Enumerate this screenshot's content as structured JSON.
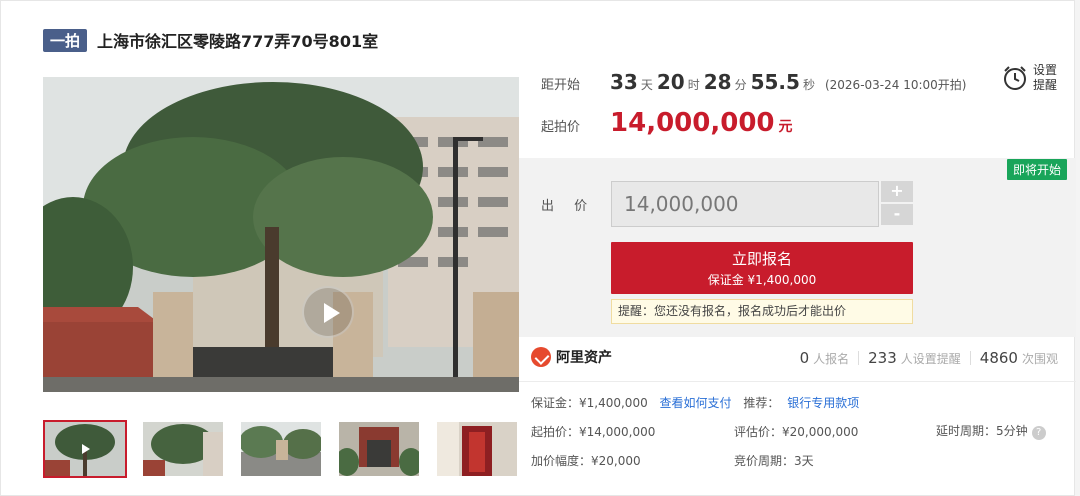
{
  "header": {
    "tag": "一拍",
    "title": "上海市徐汇区零陵路777弄70号801室"
  },
  "countdown": {
    "label": "距开始",
    "days": "33",
    "days_unit": "天",
    "hours": "20",
    "hours_unit": "时",
    "minutes": "28",
    "minutes_unit": "分",
    "seconds": "55.5",
    "seconds_unit": "秒",
    "start_note": "(2026-03-24 10:00开拍)"
  },
  "reminder": {
    "label": "设置提醒",
    "icon": "alarm-clock-icon"
  },
  "starting_price": {
    "label": "起拍价",
    "value": "14,000,000",
    "unit": "元"
  },
  "bid": {
    "badge": "即将开始",
    "label": "出 价",
    "value": "14,000,000",
    "plus": "+",
    "minus": "-",
    "signup_title": "立即报名",
    "signup_deposit": "保证金 ¥1,400,000",
    "notice": "提醒：您还没有报名，报名成功后才能出价"
  },
  "platform": {
    "name": "阿里资产",
    "icon": "ali-assets-logo-icon"
  },
  "stats": [
    {
      "value": "0",
      "label": "人报名"
    },
    {
      "value": "233",
      "label": "人设置提醒"
    },
    {
      "value": "4860",
      "label": "次围观"
    }
  ],
  "info": {
    "deposit": "保证金：¥1,400,000",
    "how_to_pay": "查看如何支付",
    "recommend_label": "推荐：",
    "recommend_link": "银行专用款项",
    "starting_price": "起拍价：¥14,000,000",
    "appraisal": "评估价：¥20,000,000",
    "delay": "延时周期：5分钟",
    "increment": "加价幅度：¥20,000",
    "cycle": "竞价周期：3天"
  },
  "colors": {
    "accent": "#c81c2c",
    "badge": "#19a55a",
    "link": "#2a6fd6",
    "tag": "#4a5f8a"
  }
}
